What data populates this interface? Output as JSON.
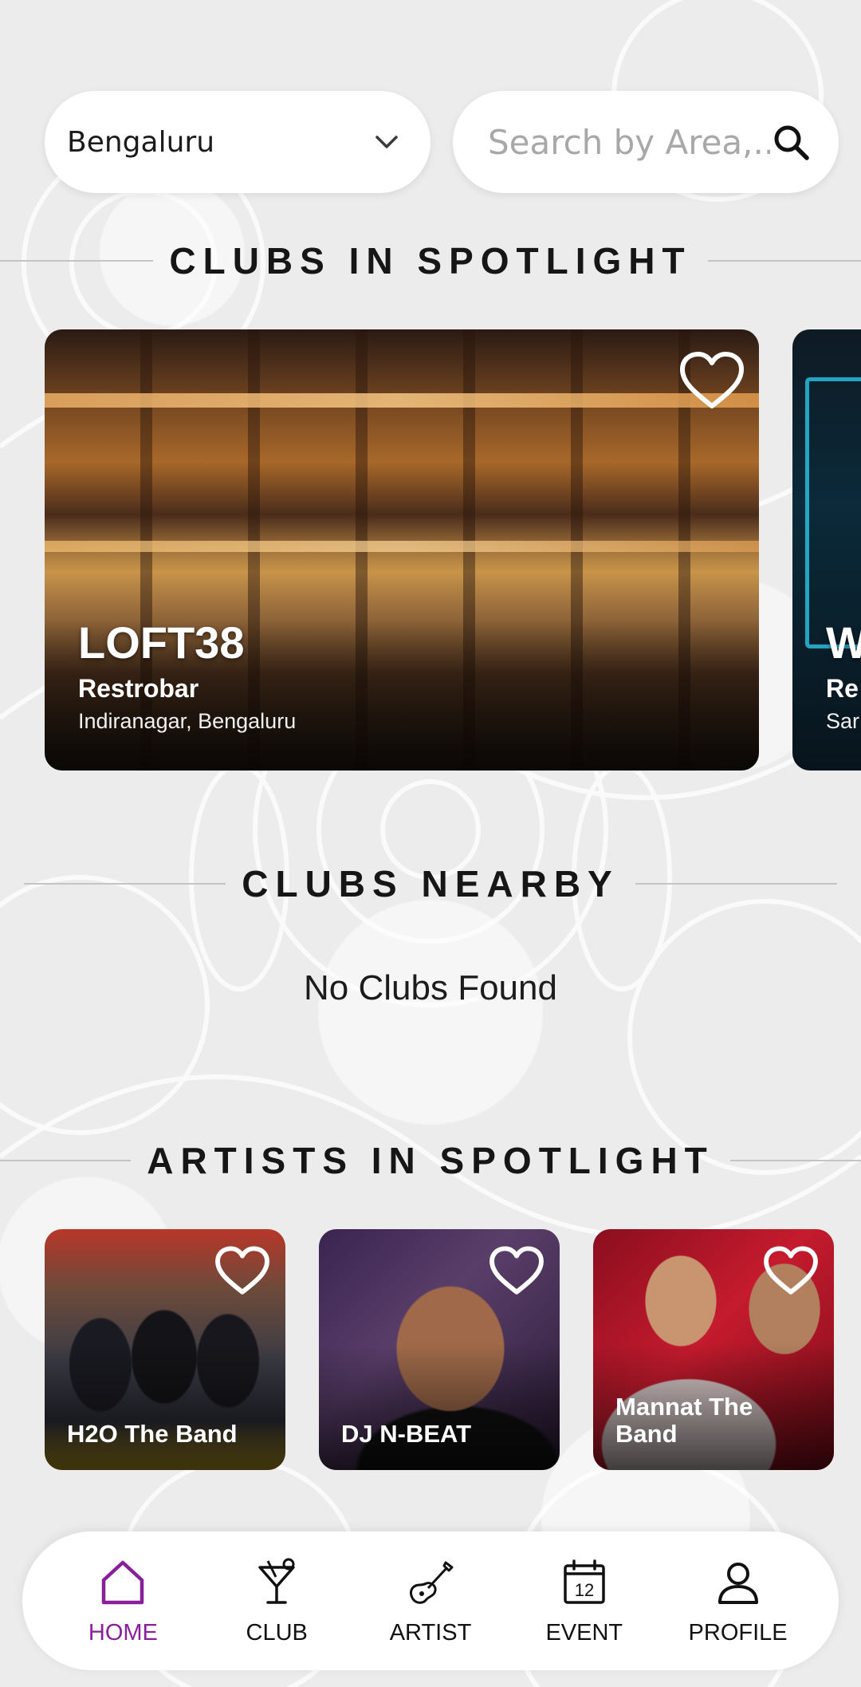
{
  "location": {
    "selected": "Bengaluru"
  },
  "search": {
    "placeholder": "Search by Area,..."
  },
  "sections": {
    "spotlight_clubs": "CLUBS IN SPOTLIGHT",
    "nearby_clubs": "CLUBS NEARBY",
    "spotlight_artists": "ARTISTS IN SPOTLIGHT"
  },
  "spotlight_clubs": [
    {
      "name": "LOFT38",
      "type": "Restrobar",
      "location": "Indiranagar, Bengaluru",
      "favorite": false
    },
    {
      "name": "W",
      "type": "Re",
      "location": "Sar",
      "favorite": false
    }
  ],
  "nearby": {
    "empty_message": "No Clubs Found"
  },
  "artists": [
    {
      "name": "H2O The Band",
      "favorite": false
    },
    {
      "name": "DJ N-BEAT",
      "favorite": false
    },
    {
      "name": "Mannat The Band",
      "favorite": false
    }
  ],
  "nav": {
    "items": [
      {
        "label": "HOME",
        "icon": "home-icon",
        "active": true
      },
      {
        "label": "CLUB",
        "icon": "cocktail-icon",
        "active": false
      },
      {
        "label": "ARTIST",
        "icon": "guitar-icon",
        "active": false
      },
      {
        "label": "EVENT",
        "icon": "calendar-icon",
        "active": false
      },
      {
        "label": "PROFILE",
        "icon": "user-icon",
        "active": false
      }
    ],
    "event_calendar_day": "12"
  },
  "colors": {
    "accent": "#8a1f9c",
    "background": "#ececec"
  }
}
